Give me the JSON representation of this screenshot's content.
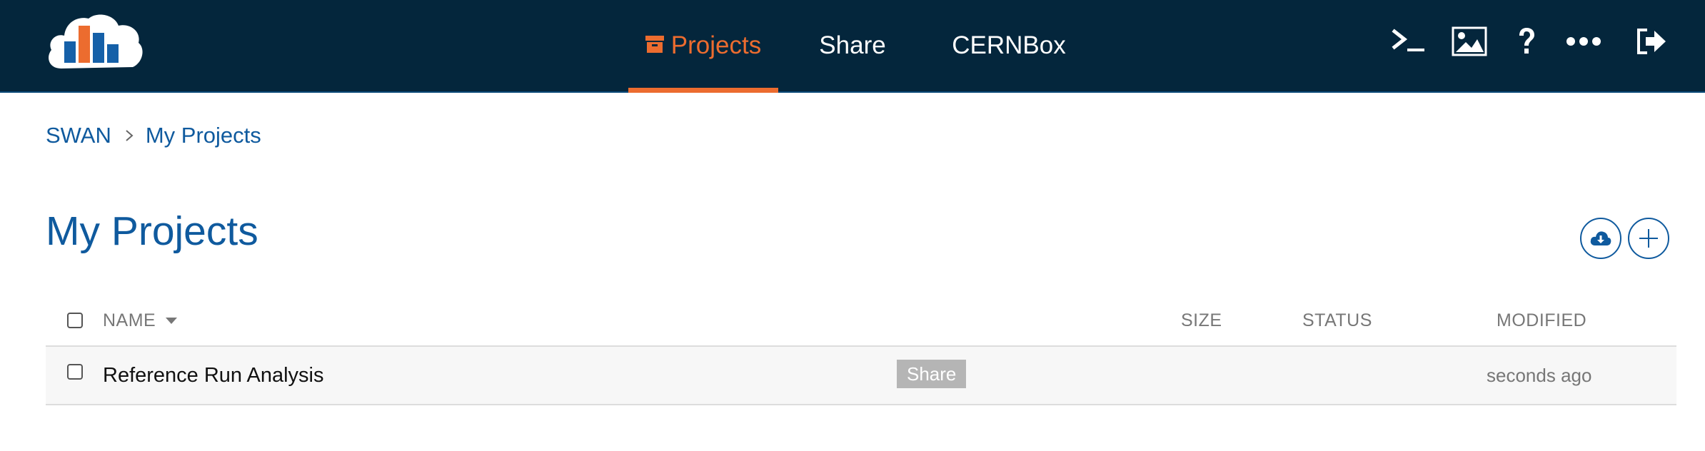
{
  "app": {
    "logo": "swan-cloud-logo"
  },
  "nav": {
    "tabs": [
      {
        "label": "Projects",
        "icon": "box-icon",
        "active": true
      },
      {
        "label": "Share",
        "active": false
      },
      {
        "label": "CERNBox",
        "active": false
      }
    ],
    "actions": [
      "terminal-icon",
      "image-icon",
      "help-icon",
      "more-icon",
      "logout-icon"
    ]
  },
  "breadcrumb": {
    "items": [
      "SWAN",
      "My Projects"
    ]
  },
  "page": {
    "title": "My Projects",
    "actions": [
      "download-cloud-icon",
      "plus-icon"
    ]
  },
  "table": {
    "columns": {
      "name": "NAME",
      "size": "SIZE",
      "status": "STATUS",
      "modified": "MODIFIED"
    },
    "rows": [
      {
        "name": "Reference Run Analysis",
        "badge": "Share",
        "size": "",
        "status": "",
        "modified": "seconds ago"
      }
    ]
  },
  "colors": {
    "navbar": "#04263c",
    "accent": "#ec6c2f",
    "link": "#0f5a9e"
  }
}
